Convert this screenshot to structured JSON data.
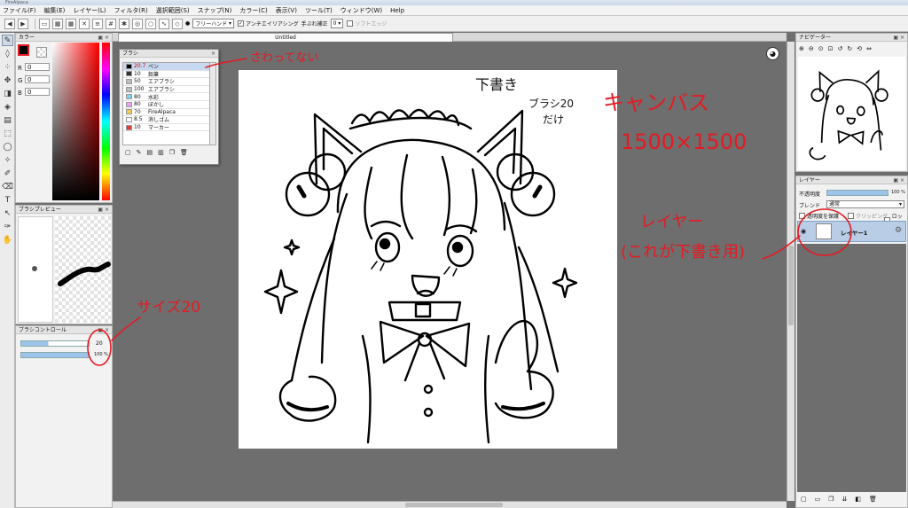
{
  "window": {
    "title": "FireAlpaca"
  },
  "menu": [
    "ファイル(F)",
    "編集(E)",
    "レイヤー(L)",
    "フィルタ(R)",
    "選択範囲(S)",
    "スナップ(N)",
    "カラー(C)",
    "表示(V)",
    "ツール(T)",
    "ウィンドウ(W)",
    "Help"
  ],
  "toolbar": {
    "brush_mode": "フリーハンド",
    "antialias_label": "アンチエイリアシング",
    "stabilizer_label": "手ぶれ補正",
    "stabilizer_value": "0",
    "softedge_label": "ソフトエッジ"
  },
  "color_panel": {
    "title": "カラー",
    "r_label": "R",
    "g_label": "G",
    "b_label": "B",
    "r": "0",
    "g": "0",
    "b": "0",
    "primary_color": "#000000"
  },
  "brush_preview": {
    "title": "ブラシプレビュー"
  },
  "brush_control": {
    "title": "ブラシコントロール",
    "size": "20",
    "opacity": "100 %"
  },
  "canvas": {
    "tab_title": "Untitled"
  },
  "brush_panel": {
    "title": "ブラシ",
    "items": [
      {
        "size": "20.7",
        "name": "ペン",
        "color": "#000000"
      },
      {
        "size": "10",
        "name": "鉛筆",
        "color": "#333333"
      },
      {
        "size": "50",
        "name": "エアブラシ",
        "color": "#bdbdbd"
      },
      {
        "size": "100",
        "name": "エアブラシ",
        "color": "#bdbdbd"
      },
      {
        "size": "80",
        "name": "水彩",
        "color": "#7fd3ef"
      },
      {
        "size": "80",
        "name": "ぼかし",
        "color": "#f0a0f0"
      },
      {
        "size": "70",
        "name": "FireAlpaca",
        "color": "#f2c94c"
      },
      {
        "size": "8.5",
        "name": "消しゴム",
        "color": "#ffffff"
      },
      {
        "size": "10",
        "name": "マーカー",
        "color": "#e53935"
      }
    ]
  },
  "navigator": {
    "title": "ナビゲーター"
  },
  "layer_panel": {
    "title": "レイヤー",
    "opacity_label": "不透明度",
    "opacity_value": "100 %",
    "blend_label": "ブレンド",
    "blend_value": "通常",
    "protect_label": "透明度を保護",
    "clipping_label": "クリッピング",
    "lock_label": "ロック",
    "layer_name": "レイヤー1"
  },
  "annotations": {
    "not_touched": "さわってない",
    "draft": "下書き",
    "brush20": "ブラシ20",
    "only": "だけ",
    "canvas": "キャンバス",
    "canvas_size": "1500×1500",
    "layer": "レイヤー",
    "layer_note": "(これが下書き用)",
    "size20": "サイズ20"
  },
  "accent_red": "#e31b23"
}
